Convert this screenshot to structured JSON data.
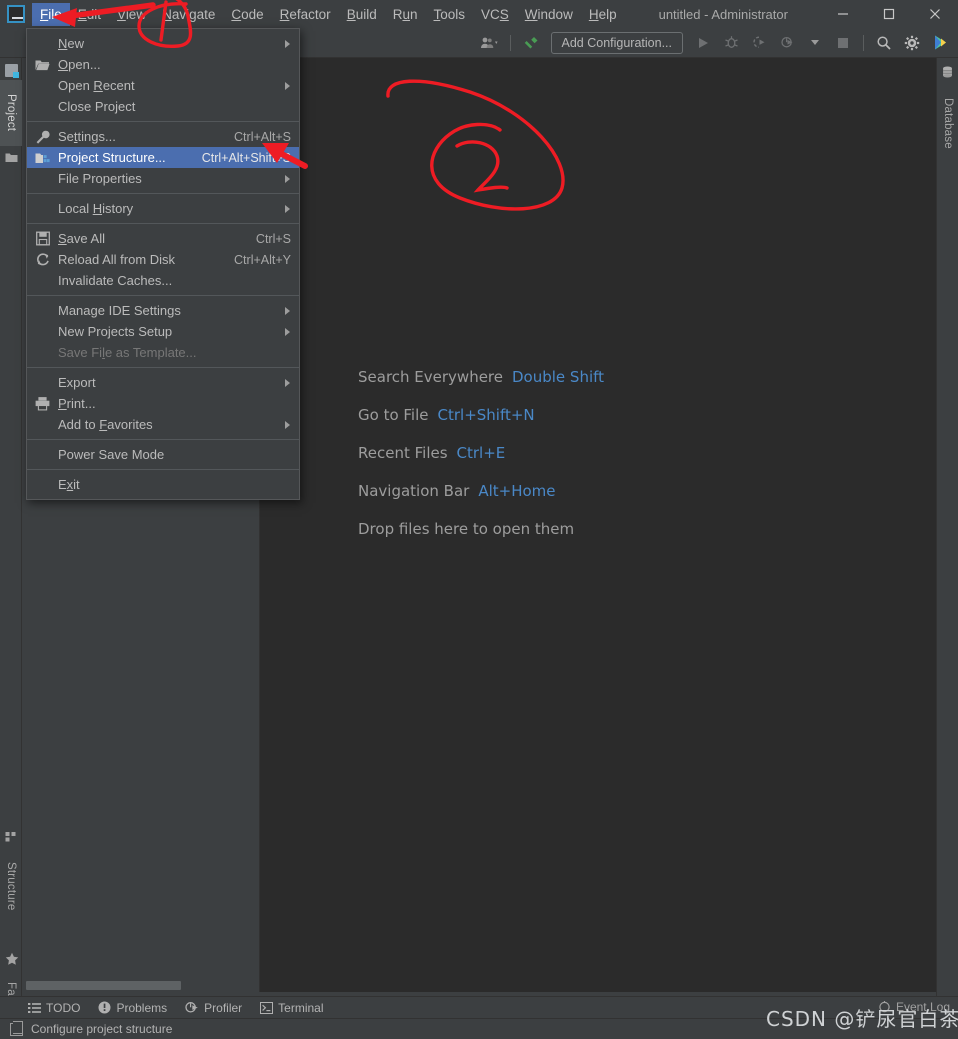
{
  "window": {
    "title": "untitled - Administrator",
    "minimize_label": "—",
    "maximize_label": "☐",
    "close_label": "✕",
    "logo_text": "IJ"
  },
  "menubar": {
    "items": [
      {
        "label": "File",
        "mnemonic": "F",
        "active": true
      },
      {
        "label": "Edit",
        "mnemonic": "E",
        "active": false
      },
      {
        "label": "View",
        "mnemonic": "V",
        "active": false
      },
      {
        "label": "Navigate",
        "mnemonic": "N",
        "active": false
      },
      {
        "label": "Code",
        "mnemonic": "C",
        "active": false
      },
      {
        "label": "Refactor",
        "mnemonic": "R",
        "active": false
      },
      {
        "label": "Build",
        "mnemonic": "B",
        "active": false
      },
      {
        "label": "Run",
        "mnemonic": "u",
        "active": false
      },
      {
        "label": "Tools",
        "mnemonic": "T",
        "active": false
      },
      {
        "label": "VCS",
        "mnemonic": "S",
        "active": false
      },
      {
        "label": "Window",
        "mnemonic": "W",
        "active": false
      },
      {
        "label": "Help",
        "mnemonic": "H",
        "active": false
      }
    ]
  },
  "toolbar": {
    "add_configuration_label": "Add Configuration...",
    "icons": [
      "user-dropdown-icon",
      "hammer-build-icon",
      "run-icon",
      "debug-icon",
      "run-coverage-icon",
      "profile-icon",
      "stop-icon",
      "search-icon",
      "settings-gear-icon",
      "idea-updates-icon"
    ]
  },
  "file_menu": {
    "items": [
      {
        "label": "New",
        "mnemonic": "N",
        "shortcut": "",
        "submenu": true,
        "icon": "",
        "highlighted": false,
        "disabled": false
      },
      {
        "label": "Open...",
        "mnemonic": "O",
        "shortcut": "",
        "submenu": false,
        "icon": "folder-open-icon",
        "highlighted": false,
        "disabled": false
      },
      {
        "label": "Open Recent",
        "mnemonic": "R",
        "shortcut": "",
        "submenu": true,
        "icon": "",
        "highlighted": false,
        "disabled": false
      },
      {
        "label": "Close Project",
        "mnemonic": "",
        "shortcut": "",
        "submenu": false,
        "icon": "",
        "highlighted": false,
        "disabled": false
      },
      {
        "separator": true
      },
      {
        "label": "Settings...",
        "mnemonic": "t",
        "shortcut": "Ctrl+Alt+S",
        "submenu": false,
        "icon": "wrench-icon",
        "highlighted": false,
        "disabled": false
      },
      {
        "label": "Project Structure...",
        "mnemonic": "",
        "shortcut": "Ctrl+Alt+Shift+S",
        "submenu": false,
        "icon": "project-structure-icon",
        "highlighted": true,
        "disabled": false
      },
      {
        "label": "File Properties",
        "mnemonic": "",
        "shortcut": "",
        "submenu": true,
        "icon": "",
        "highlighted": false,
        "disabled": false
      },
      {
        "separator": true
      },
      {
        "label": "Local History",
        "mnemonic": "H",
        "shortcut": "",
        "submenu": true,
        "icon": "",
        "highlighted": false,
        "disabled": false
      },
      {
        "separator": true
      },
      {
        "label": "Save All",
        "mnemonic": "S",
        "shortcut": "Ctrl+S",
        "submenu": false,
        "icon": "save-icon",
        "highlighted": false,
        "disabled": false
      },
      {
        "label": "Reload All from Disk",
        "mnemonic": "",
        "shortcut": "Ctrl+Alt+Y",
        "submenu": false,
        "icon": "reload-icon",
        "highlighted": false,
        "disabled": false
      },
      {
        "label": "Invalidate Caches...",
        "mnemonic": "",
        "shortcut": "",
        "submenu": false,
        "icon": "",
        "highlighted": false,
        "disabled": false
      },
      {
        "separator": true
      },
      {
        "label": "Manage IDE Settings",
        "mnemonic": "",
        "shortcut": "",
        "submenu": true,
        "icon": "",
        "highlighted": false,
        "disabled": false
      },
      {
        "label": "New Projects Setup",
        "mnemonic": "",
        "shortcut": "",
        "submenu": true,
        "icon": "",
        "highlighted": false,
        "disabled": false
      },
      {
        "label": "Save File as Template...",
        "mnemonic": "l",
        "shortcut": "",
        "submenu": false,
        "icon": "",
        "highlighted": false,
        "disabled": true
      },
      {
        "separator": true
      },
      {
        "label": "Export",
        "mnemonic": "",
        "shortcut": "",
        "submenu": true,
        "icon": "",
        "highlighted": false,
        "disabled": false
      },
      {
        "label": "Print...",
        "mnemonic": "P",
        "shortcut": "",
        "submenu": false,
        "icon": "printer-icon",
        "highlighted": false,
        "disabled": false
      },
      {
        "label": "Add to Favorites",
        "mnemonic": "F",
        "shortcut": "",
        "submenu": true,
        "icon": "",
        "highlighted": false,
        "disabled": false
      },
      {
        "separator": true
      },
      {
        "label": "Power Save Mode",
        "mnemonic": "",
        "shortcut": "",
        "submenu": false,
        "icon": "",
        "highlighted": false,
        "disabled": false
      },
      {
        "separator": true
      },
      {
        "label": "Exit",
        "mnemonic": "x",
        "shortcut": "",
        "submenu": false,
        "icon": "",
        "highlighted": false,
        "disabled": false
      }
    ]
  },
  "left_strip": {
    "tabs": [
      {
        "label": "Project",
        "icon": "project-folder-icon",
        "selected": true
      },
      {
        "label": "Structure",
        "icon": "structure-icon",
        "selected": false
      },
      {
        "label": "Favorites",
        "icon": "star-icon",
        "selected": false
      }
    ]
  },
  "right_strip": {
    "tabs": [
      {
        "label": "Database",
        "icon": "database-icon",
        "selected": false
      }
    ]
  },
  "editor": {
    "hints": [
      {
        "action": "Search Everywhere",
        "key": "Double Shift"
      },
      {
        "action": "Go to File",
        "key": "Ctrl+Shift+N"
      },
      {
        "action": "Recent Files",
        "key": "Ctrl+E"
      },
      {
        "action": "Navigation Bar",
        "key": "Alt+Home"
      },
      {
        "action": "Drop files here to open them",
        "key": ""
      }
    ]
  },
  "bottom_bar": {
    "items": [
      {
        "label": "TODO",
        "icon": "todo-list-icon"
      },
      {
        "label": "Problems",
        "icon": "problems-warning-icon"
      },
      {
        "label": "Profiler",
        "icon": "profiler-icon"
      },
      {
        "label": "Terminal",
        "icon": "terminal-icon"
      }
    ],
    "event_log_label": "Event Log",
    "event_log_icon": "event-log-icon"
  },
  "status_bar": {
    "message": "Configure project structure",
    "icon": "popup-hint-icon"
  },
  "watermark": {
    "text": "CSDN @铲尿官白茶"
  },
  "annotations": {
    "accent_color": "#ee1c24",
    "marks": [
      {
        "name": "circle-1-over-navigate",
        "text": "1"
      },
      {
        "name": "arrow-to-file-menu",
        "text": ""
      },
      {
        "name": "circle-2-in-editor",
        "text": "2"
      },
      {
        "name": "arrow-to-project-structure",
        "text": ""
      }
    ]
  },
  "colors": {
    "chrome_bg": "#3c3f41",
    "editor_bg": "#2b2b2b",
    "selection_blue": "#4b6eaf",
    "link_blue": "#4a88c7",
    "text": "#bbbbbb",
    "annotation_red": "#ee1c24"
  }
}
